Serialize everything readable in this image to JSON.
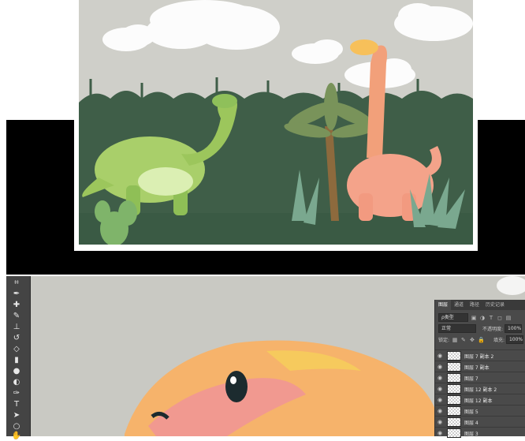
{
  "panel": {
    "tabs": [
      "图层",
      "通道",
      "路径",
      "历史记录"
    ],
    "filter_label": "ρ类型",
    "blend_mode": "正常",
    "opacity_label": "不透明度:",
    "opacity_value": "100%",
    "lock_label": "锁定:",
    "fill_label": "填充:",
    "fill_value": "100%",
    "layers": [
      {
        "name": "图层 7 副本 2"
      },
      {
        "name": "图层 7 副本"
      },
      {
        "name": "图层 7"
      },
      {
        "name": "图层 12 副本 2"
      },
      {
        "name": "图层 12 副本"
      },
      {
        "name": "图层 5"
      },
      {
        "name": "图层 4"
      },
      {
        "name": "图层 3"
      }
    ]
  },
  "toolbar": {
    "tools": [
      {
        "icon": "crop-icon"
      },
      {
        "icon": "eyedropper-icon"
      },
      {
        "icon": "healing-brush-icon"
      },
      {
        "icon": "brush-icon"
      },
      {
        "icon": "clone-stamp-icon"
      },
      {
        "icon": "history-brush-icon"
      },
      {
        "icon": "eraser-icon"
      },
      {
        "icon": "gradient-icon"
      },
      {
        "icon": "blur-icon"
      },
      {
        "icon": "dodge-icon"
      },
      {
        "icon": "pen-icon"
      },
      {
        "icon": "type-icon"
      },
      {
        "icon": "path-selection-icon"
      },
      {
        "icon": "shape-icon"
      },
      {
        "icon": "hand-icon"
      }
    ]
  },
  "colors": {
    "scene_green": "#3f5e48",
    "sky_gray": "#cfcfc9",
    "panel_bg": "#4a4a4a"
  }
}
